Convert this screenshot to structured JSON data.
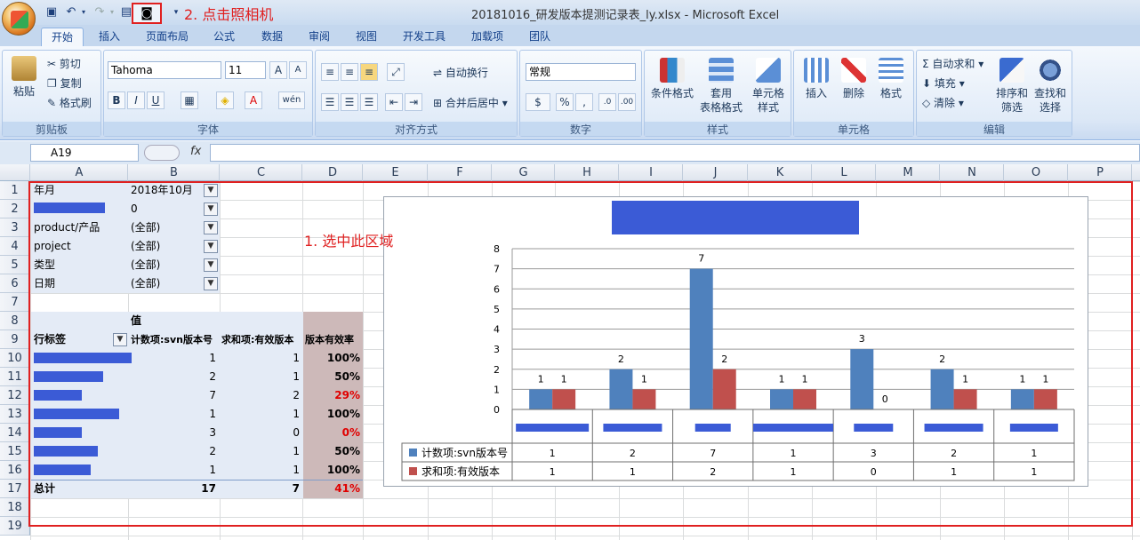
{
  "window": {
    "title": "20181016_研发版本提测记录表_ly.xlsx - Microsoft Excel"
  },
  "annotations": {
    "step1": "1. 选中此区域",
    "step2": "2. 点击照相机"
  },
  "tabs": [
    "开始",
    "插入",
    "页面布局",
    "公式",
    "数据",
    "审阅",
    "视图",
    "开发工具",
    "加载项",
    "团队"
  ],
  "ribbon": {
    "clipboard": {
      "paste": "粘贴",
      "cut": "剪切",
      "copy": "复制",
      "format_painter": "格式刷",
      "label": "剪贴板"
    },
    "font": {
      "name": "Tahoma",
      "size": "11",
      "label": "字体"
    },
    "alignment": {
      "wrap": "自动换行",
      "merge": "合并后居中",
      "label": "对齐方式"
    },
    "number": {
      "format": "常规",
      "label": "数字"
    },
    "styles": {
      "conditional": "条件格式",
      "table1": "套用",
      "table2": "表格格式",
      "cell1": "单元格",
      "cell2": "样式",
      "label": "样式"
    },
    "cells": {
      "insert": "插入",
      "delete": "删除",
      "format": "格式",
      "label": "单元格"
    },
    "editing": {
      "autosum": "自动求和",
      "fill": "填充",
      "clear": "清除",
      "sort1": "排序和",
      "sort2": "筛选",
      "find1": "查找和",
      "find2": "选择",
      "label": "编辑"
    }
  },
  "formula_bar": {
    "name_box": "A19",
    "fx": "fx"
  },
  "columns": [
    "A",
    "B",
    "C",
    "D",
    "E",
    "F",
    "G",
    "H",
    "I",
    "J",
    "K",
    "L",
    "M",
    "N",
    "O",
    "P"
  ],
  "rows": [
    "1",
    "2",
    "3",
    "4",
    "5",
    "6",
    "7",
    "8",
    "9",
    "10",
    "11",
    "12",
    "13",
    "14",
    "15",
    "16",
    "17",
    "18",
    "19"
  ],
  "pivot": {
    "filters": [
      {
        "label": "年月",
        "value": "2018年10月"
      },
      {
        "label": "",
        "value": "0"
      },
      {
        "label": "product/产品",
        "value": "(全部)"
      },
      {
        "label": "project",
        "value": "(全部)"
      },
      {
        "label": "类型",
        "value": "(全部)"
      },
      {
        "label": "日期",
        "value": "(全部)"
      }
    ],
    "values_header": "值",
    "row_label": "行标签",
    "col1": "计数项:svn版本号",
    "col2": "求和项:有效版本",
    "col3": "版本有效率",
    "rows": [
      {
        "b": "1",
        "c": "1",
        "d": "100%",
        "red": false
      },
      {
        "b": "2",
        "c": "1",
        "d": "50%",
        "red": false
      },
      {
        "b": "7",
        "c": "2",
        "d": "29%",
        "red": true
      },
      {
        "b": "1",
        "c": "1",
        "d": "100%",
        "red": false
      },
      {
        "b": "3",
        "c": "0",
        "d": "0%",
        "red": true
      },
      {
        "b": "2",
        "c": "1",
        "d": "50%",
        "red": false
      },
      {
        "b": "1",
        "c": "1",
        "d": "100%",
        "red": false
      }
    ],
    "total": {
      "label": "总计",
      "b": "17",
      "c": "7",
      "d": "41%"
    }
  },
  "chart_data": {
    "type": "bar",
    "categories": [
      "",
      "",
      "",
      "",
      "",
      "",
      ""
    ],
    "series": [
      {
        "name": "计数项:svn版本号",
        "values": [
          1,
          2,
          7,
          1,
          3,
          2,
          1
        ],
        "color": "#4f81bd"
      },
      {
        "name": "求和项:有效版本",
        "values": [
          1,
          1,
          2,
          1,
          0,
          1,
          1
        ],
        "color": "#c0504d"
      }
    ],
    "ylim": [
      0,
      8
    ],
    "yticks": [
      "0",
      "1",
      "2",
      "3",
      "4",
      "5",
      "6",
      "7",
      "8"
    ],
    "grid": true,
    "data_table": true
  }
}
